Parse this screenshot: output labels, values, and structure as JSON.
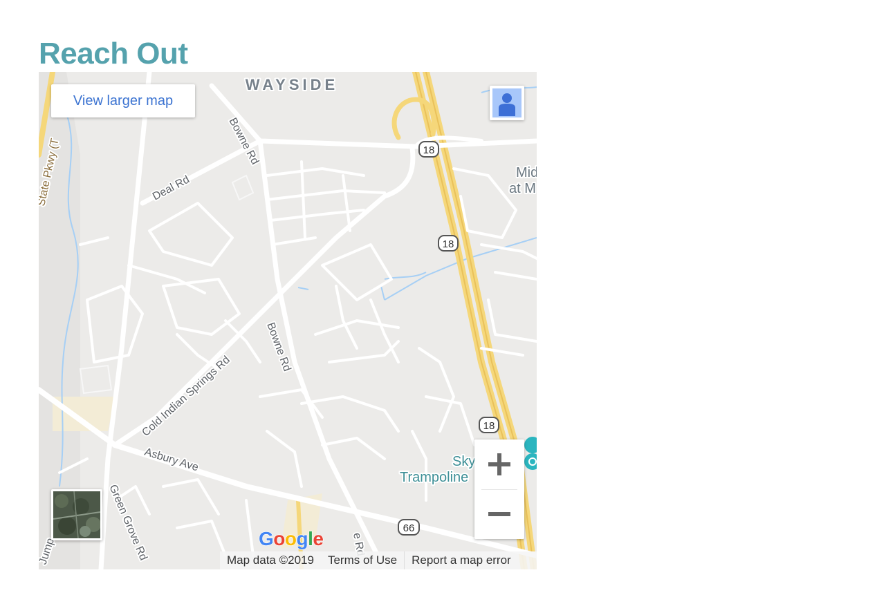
{
  "page": {
    "heading": "Reach Out"
  },
  "map": {
    "view_larger_label": "View larger map",
    "area_label": "WAYSIDE",
    "roads": {
      "bowne_upper": "Bowne Rd",
      "bowne_mid": "Bowne Rd",
      "bowne_lower": "e Rd",
      "deal": "Deal Rd",
      "cold_indian_springs": "Cold Indian Springs Rd",
      "asbury": "Asbury Ave",
      "green_grove": "Green Grove Rd",
      "parkway": "State Pkwy (T",
      "jump": "Jump"
    },
    "route_shields": [
      "18",
      "18",
      "18",
      "66"
    ],
    "places": {
      "mid_line1": "Mid",
      "mid_line2": "at M",
      "sky_line1": "Sky",
      "sky_line2": "Trampoline"
    },
    "google_logo": [
      "G",
      "o",
      "o",
      "g",
      "l",
      "e"
    ],
    "footer": {
      "map_data": "Map data ©2019",
      "terms": "Terms of Use",
      "report": "Report a map error"
    },
    "colors": {
      "land": "#ecebe9",
      "road": "#ffffff",
      "highway": "#f5d77a",
      "water": "#a6cff5",
      "heading": "#55a2ad",
      "link": "#3b73d1"
    },
    "icons": {
      "pegman": "street-view-pegman-icon",
      "zoom_in": "plus-icon",
      "zoom_out": "minus-icon",
      "poi": "trampoline-park-poi-icon"
    }
  }
}
